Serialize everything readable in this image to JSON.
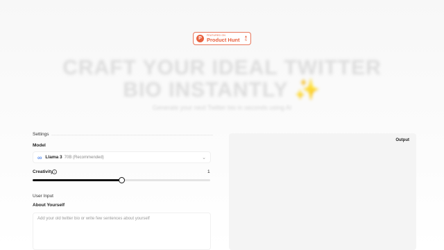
{
  "badge": {
    "small_text": "FEATURED ON",
    "name": "Product Hunt",
    "arrow": "▲",
    "count": "6",
    "brand_color": "#e8613f"
  },
  "hero": {
    "title": "CRAFT YOUR IDEAL TWITTER BIO INSTANTLY ✨",
    "subtitle": "Generate your next Twitter bio in seconds using AI"
  },
  "settings": {
    "title": "Settings",
    "model_label": "Model",
    "model": {
      "icon": "meta-icon",
      "name": "Llama 3",
      "detail": "70B (Recommended)"
    },
    "creativity_label": "Creativity",
    "creativity_value": "1",
    "creativity_fraction": 0.5,
    "user_input_title": "User Input",
    "about_label": "About Yourself",
    "about_placeholder": "Add your old twitter bio or write few sentences about yourself"
  },
  "output": {
    "label": "Output"
  }
}
